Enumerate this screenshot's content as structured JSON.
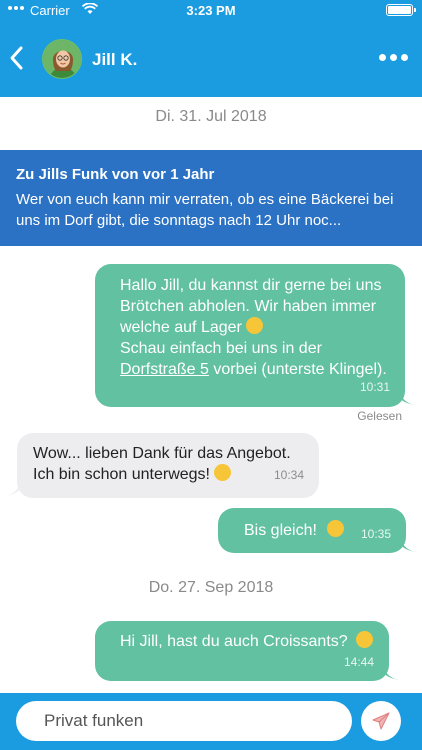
{
  "status": {
    "carrier": "Carrier",
    "time": "3:23 PM"
  },
  "header": {
    "contact_name": "Jill K."
  },
  "messages_day1": {
    "date": "Di. 31. Jul 2018"
  },
  "banner": {
    "title": "Zu Jills Funk von vor 1 Jahr",
    "text": "Wer von euch kann mir verraten, ob es eine Bäckerei bei uns im Dorf gibt, die sonntags nach 12 Uhr noc..."
  },
  "msg1": {
    "line1": "Hallo Jill, du kannst dir gerne bei uns",
    "line2": "Brötchen abholen. Wir haben immer",
    "line3": "welche auf Lager",
    "line4": "Schau einfach bei uns in der",
    "link": "Dorfstraße 5",
    "line5_rest": " vorbei (unterste Klingel).",
    "time": "10:31",
    "read_receipt": "Gelesen"
  },
  "msg2": {
    "line1": "Wow... lieben Dank für das Angebot.",
    "line2": "Ich bin schon unterwegs!",
    "time": "10:34"
  },
  "msg3": {
    "text": "Bis gleich!",
    "time": "10:35"
  },
  "messages_day2": {
    "date": "Do. 27. Sep 2018"
  },
  "msg4": {
    "text": "Hi Jill, hast du auch Croissants?",
    "time": "14:44"
  },
  "composer": {
    "placeholder": "Privat funken"
  },
  "colors": {
    "header": "#1b9be0",
    "outgoing": "#62c1a1",
    "incoming": "#ededf0",
    "banner": "#2b72c4"
  }
}
